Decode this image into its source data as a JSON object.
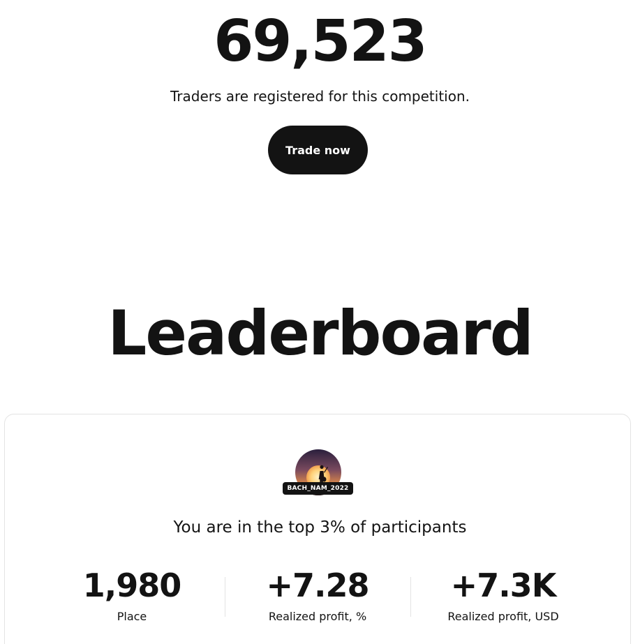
{
  "hero": {
    "count": "69,523",
    "subtitle": "Traders are registered for this competition.",
    "cta_label": "Trade now"
  },
  "leaderboard": {
    "title": "Leaderboard",
    "user": {
      "nickname": "BACH_NAM_2022",
      "avatar_icon": "avatar-sunset-silhouette"
    },
    "rank_message": "You are in the top 3% of participants",
    "stats": [
      {
        "value": "1,980",
        "label": "Place"
      },
      {
        "value": "+7.28",
        "label": "Realized profit, %"
      },
      {
        "value": "+7.3K",
        "label": "Realized profit, USD"
      }
    ]
  },
  "colors": {
    "text": "#131313",
    "button_bg": "#131313",
    "button_text": "#ffffff",
    "card_border": "#e3e3e3"
  }
}
